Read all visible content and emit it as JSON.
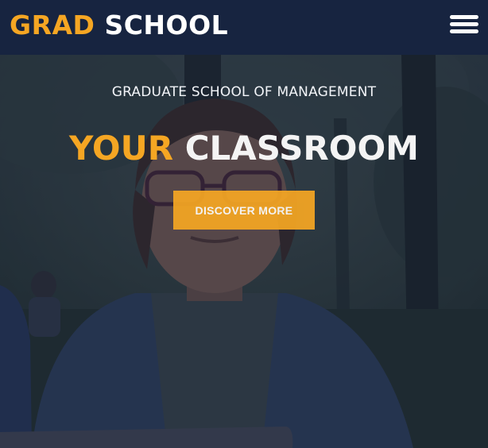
{
  "header": {
    "logo_accent": "GRAD",
    "logo_text": "SCHOOL",
    "menu_icon": "hamburger-menu-icon"
  },
  "hero": {
    "kicker": "GRADUATE SCHOOL OF MANAGEMENT",
    "headline_accent": "YOUR",
    "headline_text": "CLASSROOM",
    "cta_label": "DISCOVER MORE"
  },
  "colors": {
    "accent": "#f5a623",
    "header_bg": "#172440",
    "overlay": "#141c34"
  }
}
